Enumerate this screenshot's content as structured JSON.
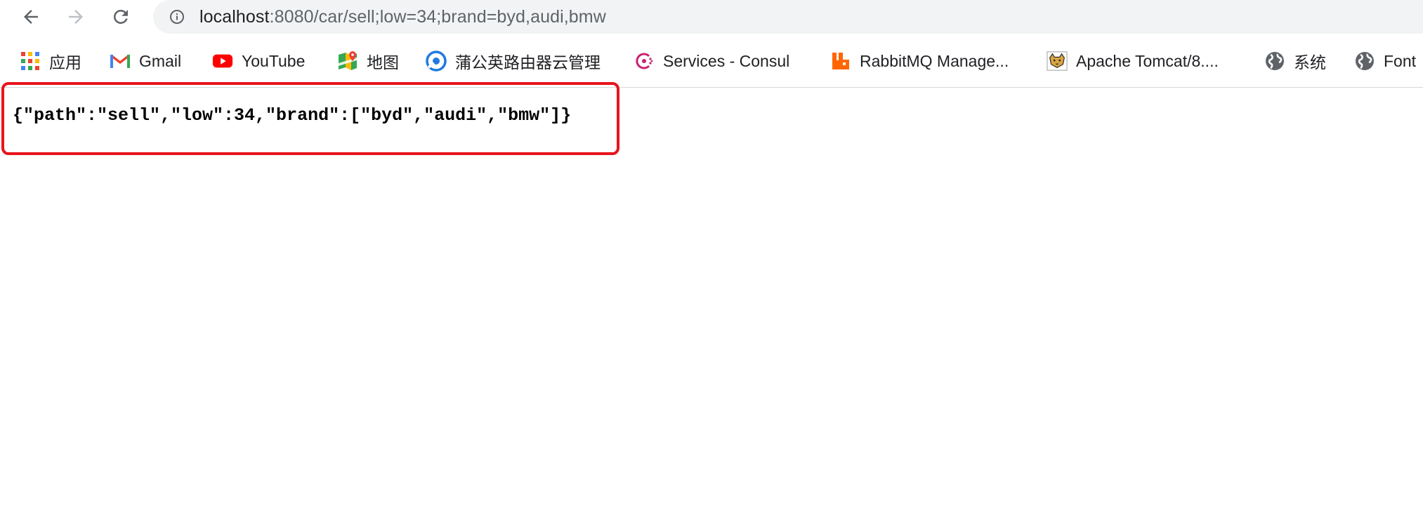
{
  "browser": {
    "address": {
      "host": "localhost",
      "rest": ":8080/car/sell;low=34;brand=byd,audi,bmw"
    },
    "bookmarks": [
      {
        "label": "应用",
        "icon": "apps-grid-icon"
      },
      {
        "label": "Gmail",
        "icon": "gmail-icon"
      },
      {
        "label": "YouTube",
        "icon": "youtube-icon"
      },
      {
        "label": "地图",
        "icon": "maps-icon"
      },
      {
        "label": "蒲公英路由器云管理",
        "icon": "pgy-icon"
      },
      {
        "label": "Services - Consul",
        "icon": "consul-icon"
      },
      {
        "label": "RabbitMQ Manage...",
        "icon": "rabbitmq-icon"
      },
      {
        "label": "Apache Tomcat/8....",
        "icon": "tomcat-icon"
      },
      {
        "label": "系统",
        "icon": "globe-icon"
      },
      {
        "label": "Font",
        "icon": "globe-icon"
      }
    ]
  },
  "page": {
    "response_body": "{\"path\":\"sell\",\"low\":34,\"brand\":[\"byd\",\"audi\",\"bmw\"]}"
  },
  "colors": {
    "highlight": "#e8141c",
    "omnibox_bg": "#f1f3f4"
  }
}
